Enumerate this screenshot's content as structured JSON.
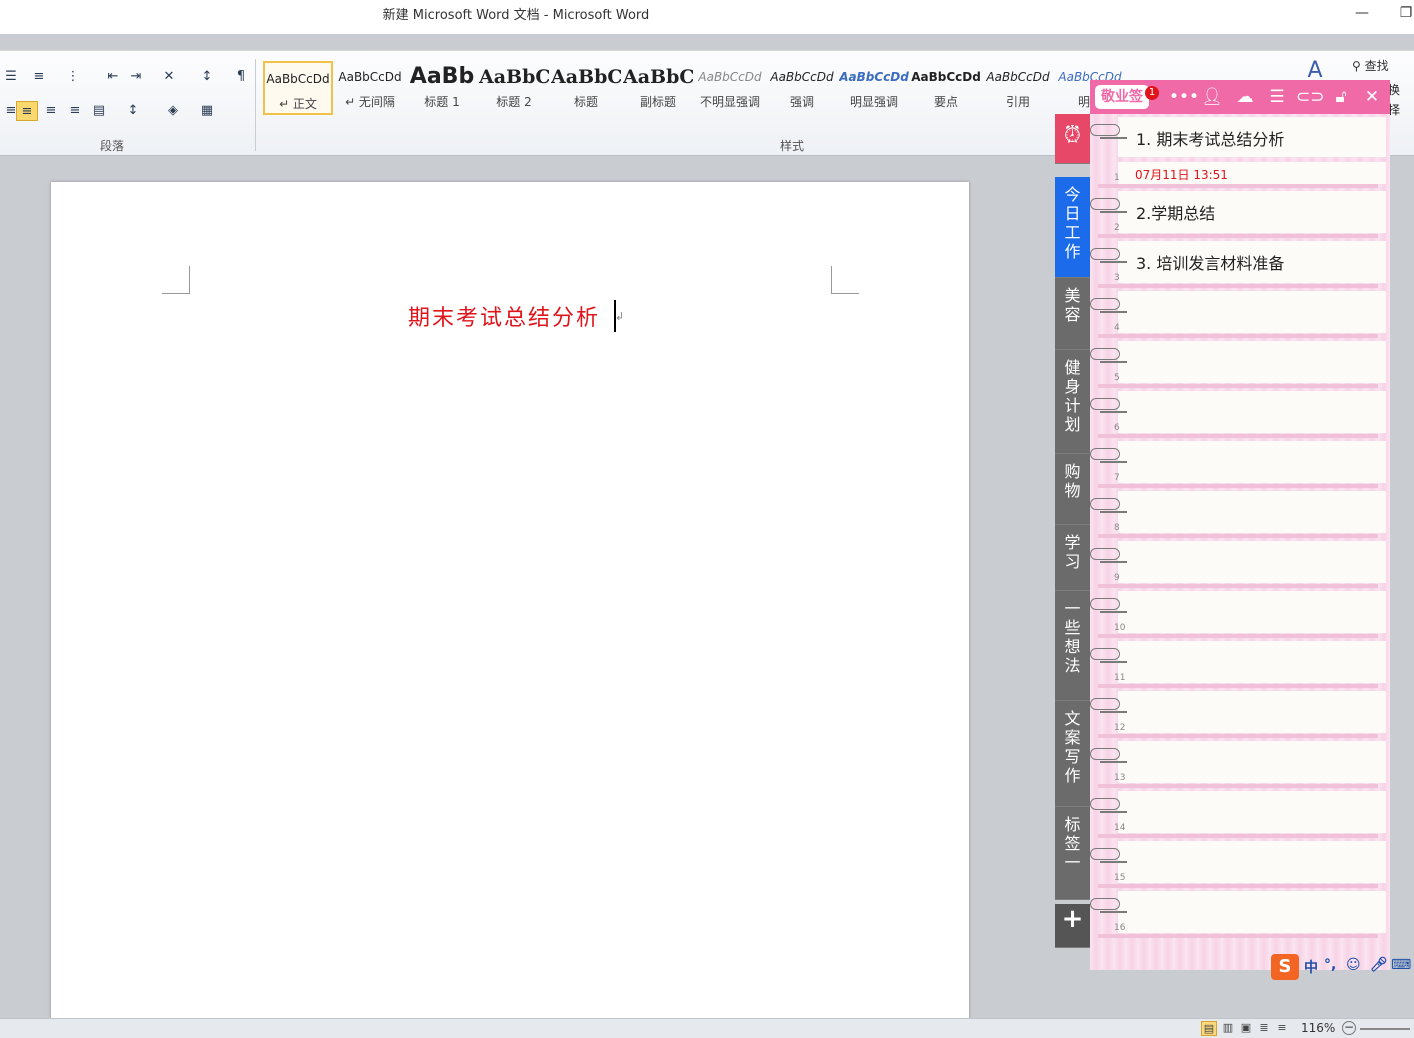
{
  "window": {
    "title": "新建 Microsoft Word 文档 - Microsoft Word",
    "minimize_glyph": "—",
    "restore_glyph": "❐"
  },
  "ribbon": {
    "paragraph_group_label": "段落",
    "styles_group_label": "样式",
    "find_label": "查找",
    "replace_fragment": "换",
    "select_fragment": "择",
    "styles": [
      {
        "sample": "AaBbCcDd",
        "label": "↵ 正文"
      },
      {
        "sample": "AaBbCcDd",
        "label": "↵ 无间隔"
      },
      {
        "sample": "AaBb",
        "label": "标题 1"
      },
      {
        "sample": "AaBbC",
        "label": "标题 2"
      },
      {
        "sample": "AaBbC",
        "label": "标题"
      },
      {
        "sample": "AaBbC",
        "label": "副标题"
      },
      {
        "sample": "AaBbCcDd",
        "label": "不明显强调"
      },
      {
        "sample": "AaBbCcDd",
        "label": "强调"
      },
      {
        "sample": "AaBbCcDd",
        "label": "明显强调"
      },
      {
        "sample": "AaBbCcDd",
        "label": "要点"
      },
      {
        "sample": "AaBbCcDd",
        "label": "引用"
      },
      {
        "sample": "AaBbCcDd",
        "label": "明显"
      }
    ]
  },
  "document": {
    "heading": "期末考试总结分析",
    "heading_color": "#e0141b",
    "paragraph_mark": "↲"
  },
  "statusbar": {
    "zoom": "116%"
  },
  "sticky": {
    "brand": "敬业签",
    "badge": "1",
    "tabs": [
      {
        "label": "今日工作",
        "active": true
      },
      {
        "label": "美容"
      },
      {
        "label": "健身计划"
      },
      {
        "label": "购物"
      },
      {
        "label": "学习"
      },
      {
        "label": "一些想法"
      },
      {
        "label": "文案写作"
      },
      {
        "label": "标签一"
      }
    ],
    "add_tab": "+",
    "notes": [
      {
        "num": "1",
        "text": "1. 期末考试总结分析",
        "time": "07月11日 13:51"
      },
      {
        "num": "2",
        "text": "2.学期总结"
      },
      {
        "num": "3",
        "text": "3. 培训发言材料准备"
      },
      {
        "num": "4",
        "text": ""
      },
      {
        "num": "5",
        "text": ""
      },
      {
        "num": "6",
        "text": ""
      },
      {
        "num": "7",
        "text": ""
      },
      {
        "num": "8",
        "text": ""
      },
      {
        "num": "9",
        "text": ""
      },
      {
        "num": "10",
        "text": ""
      },
      {
        "num": "11",
        "text": ""
      },
      {
        "num": "12",
        "text": ""
      },
      {
        "num": "13",
        "text": ""
      },
      {
        "num": "14",
        "text": ""
      },
      {
        "num": "15",
        "text": ""
      },
      {
        "num": "16",
        "text": ""
      }
    ],
    "accent": "#f06aa8",
    "active_tab_color": "#1c6bea",
    "alarm_tab_color": "#e84868"
  },
  "ime": {
    "logo": "S",
    "mode": "中",
    "punct": "°,"
  }
}
